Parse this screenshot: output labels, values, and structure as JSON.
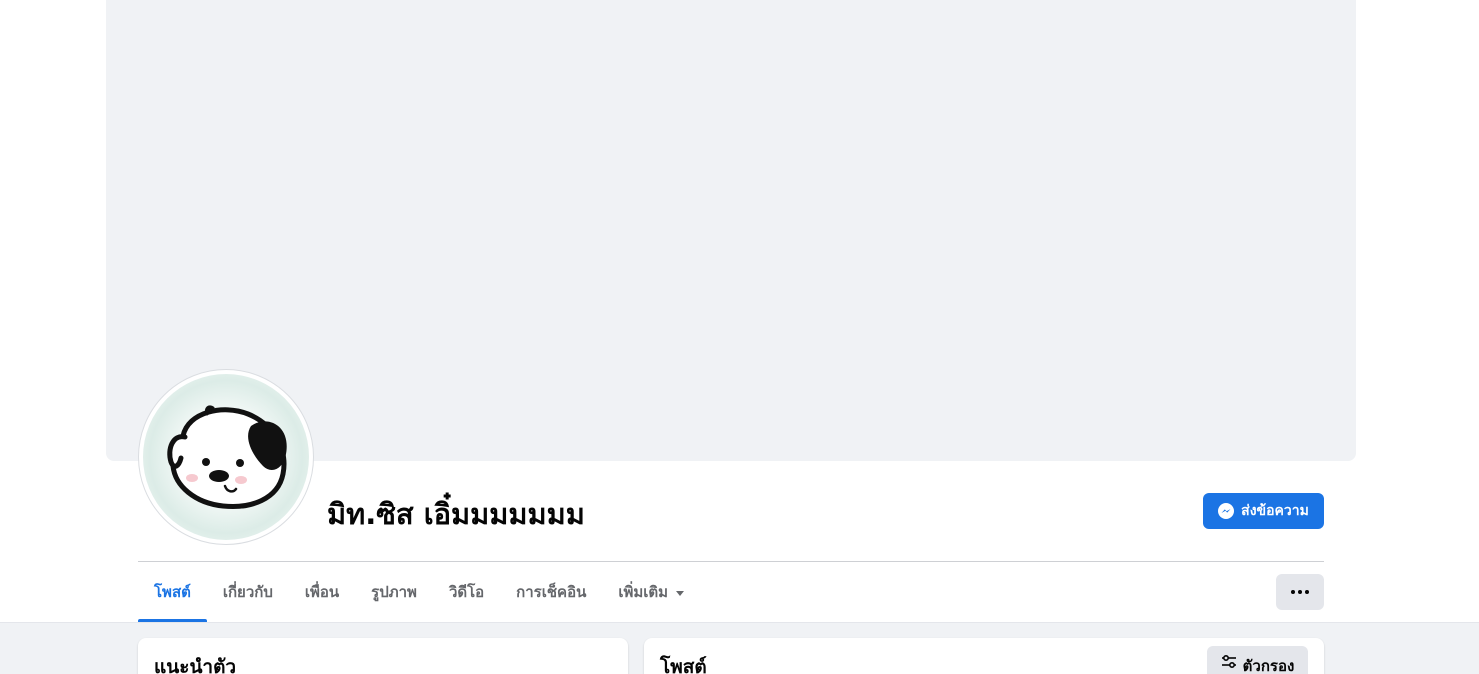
{
  "profile": {
    "name": "มิท.ซิส เอิ๋มมมมมมม"
  },
  "actions": {
    "message_label": "ส่งข้อความ",
    "message_icon": "messenger-icon",
    "more_icon": "ellipsis-icon"
  },
  "tabs": [
    {
      "label": "โพสต์",
      "active": true
    },
    {
      "label": "เกี่ยวกับ",
      "active": false
    },
    {
      "label": "เพื่อน",
      "active": false
    },
    {
      "label": "รูปภาพ",
      "active": false
    },
    {
      "label": "วิดีโอ",
      "active": false
    },
    {
      "label": "การเช็คอิน",
      "active": false
    },
    {
      "label": "เพิ่มเติม",
      "active": false,
      "has_dropdown": true
    }
  ],
  "intro_card": {
    "title": "แนะนำตัว"
  },
  "posts_card": {
    "title": "โพสต์",
    "filter_label": "ตัวกรอง",
    "filter_icon": "sliders-icon"
  },
  "colors": {
    "accent": "#1b74e4",
    "cover": "#f0f2f5",
    "tab_text": "#65676b",
    "text_primary": "#050505"
  }
}
